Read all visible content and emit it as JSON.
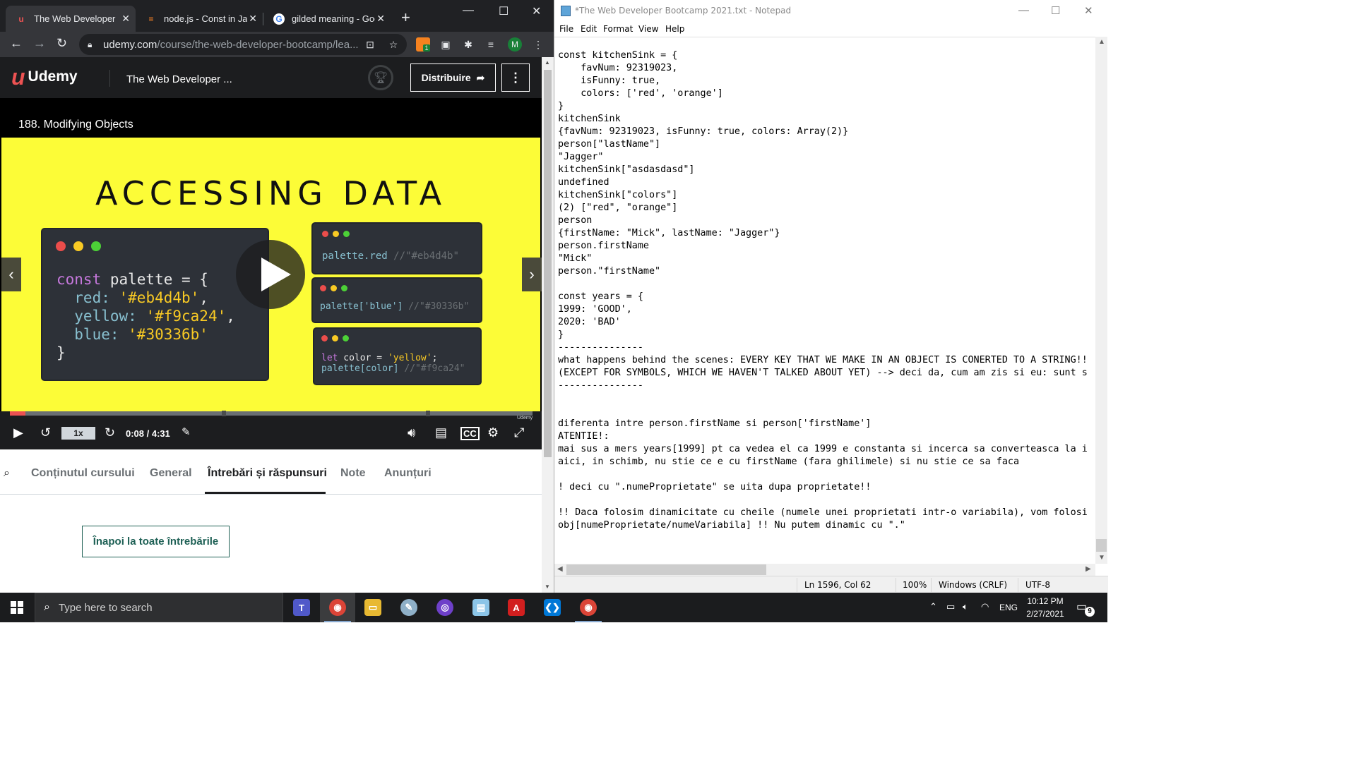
{
  "chrome": {
    "tabs": [
      {
        "title": "The Web Developer B",
        "favicon": "udemy-icon",
        "active": true
      },
      {
        "title": "node.js - Const in Jav",
        "favicon": "stackoverflow-icon",
        "active": false
      },
      {
        "title": "gilded meaning - Goo",
        "favicon": "google-icon",
        "active": false
      }
    ],
    "new_tab": "+",
    "omnibox": {
      "host": "udemy.com",
      "path": "/course/the-web-developer-bootcamp/lea..."
    },
    "profile_initial": "M",
    "extension_badge": "1"
  },
  "udemy": {
    "logo_text": "Udemy",
    "course_title": "The Web Developer ...",
    "share_label": "Distribuire",
    "lecture_title": "188. Modifying Objects",
    "slide": {
      "heading": "ACCESSING DATA",
      "code_main": {
        "line1_kw": "const",
        "line1_rest": " palette = {",
        "line2_key": "  red: ",
        "line2_val": "'#eb4d4b'",
        "line2_end": ",",
        "line3_key": "  yellow: ",
        "line3_val": "'#f9ca24'",
        "line3_end": ",",
        "line4_key": "  blue: ",
        "line4_val": "'#30336b'",
        "line5": "}"
      },
      "code_a": {
        "code": "palette.red ",
        "comment": "//\"#eb4d4b\""
      },
      "code_b": {
        "code": "palette['blue'] ",
        "comment": "//\"#30336b\""
      },
      "code_c": {
        "line1_kw": "let",
        "line1_mid": " color = ",
        "line1_str": "'yellow'",
        "line1_end": ";",
        "line2_code": "palette[color] ",
        "line2_comment": "//\"#f9ca24\""
      }
    },
    "player": {
      "rate": "1x",
      "time": "0:08 / 4:31",
      "progress": 0.03,
      "watermark": "Udemy"
    },
    "course_tabs": [
      "Conținutul cursului",
      "General",
      "Întrebări și răspunsuri",
      "Note",
      "Anunțuri"
    ],
    "active_tab": "Întrebări și răspunsuri",
    "back_button": "Înapoi la toate întrebările"
  },
  "notepad": {
    "title": "*The Web Developer Bootcamp 2021.txt - Notepad",
    "menu": [
      "File",
      "Edit",
      "Format",
      "View",
      "Help"
    ],
    "text": "const kitchenSink = {\n    favNum: 92319023,\n    isFunny: true,\n    colors: ['red', 'orange']\n}\nkitchenSink\n{favNum: 92319023, isFunny: true, colors: Array(2)}\nperson[\"lastName\"]\n\"Jagger\"\nkitchenSink[\"asdasdasd\"]\nundefined\nkitchenSink[\"colors\"]\n(2) [\"red\", \"orange\"]\nperson\n{firstName: \"Mick\", lastName: \"Jagger\"}\nperson.firstName\n\"Mick\"\nperson.\"firstName\"\n\nconst years = {\n1999: 'GOOD',\n2020: 'BAD'\n}\n---------------\nwhat happens behind the scenes: EVERY KEY THAT WE MAKE IN AN OBJECT IS CONERTED TO A STRING!!\n(EXCEPT FOR SYMBOLS, WHICH WE HAVEN'T TALKED ABOUT YET) --> deci da, cum am zis si eu: sunt s\n---------------\n\n\ndiferenta intre person.firstName si person['firstName']\nATENTIE!:\nmai sus a mers years[1999] pt ca vedea el ca 1999 e constanta si incerca sa converteasca la i\naici, in schimb, nu stie ce e cu firstName (fara ghilimele) si nu stie ce sa faca\n\n! deci cu \".numeProprietate\" se uita dupa proprietate!!\n\n!! Daca folosim dinamicitate cu cheile (numele unei proprietati intr-o variabila), vom folosi\nobj[numeProprietate/numeVariabila] !! Nu putem dinamic cu \".\"",
    "status": {
      "position": "Ln 1596, Col 62",
      "zoom": "100%",
      "line_endings": "Windows (CRLF)",
      "encoding": "UTF-8"
    }
  },
  "taskbar": {
    "search_placeholder": "Type here to search",
    "language": "ENG",
    "time": "10:12 PM",
    "date": "2/27/2021",
    "notification_count": "9"
  },
  "colors": {
    "udemy_red": "#ec5252",
    "slide_yellow": "#fcfc37",
    "code_bg": "#2d3138",
    "teal": "#1e6055"
  }
}
